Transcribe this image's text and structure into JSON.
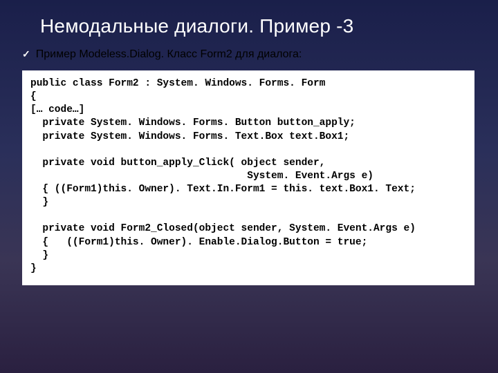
{
  "slide": {
    "title": "Немодальные диалоги. Пример -3",
    "bullet": {
      "text": "Пример Modeless.Dialog. Класс Form2 для диалога:"
    },
    "code": "public class Form2 : System. Windows. Forms. Form\n{\n[… code…]\n  private System. Windows. Forms. Button button_apply;\n  private System. Windows. Forms. Text.Box text.Box1;\n\n  private void button_apply_Click( object sender,\n                                    System. Event.Args e)\n  { ((Form1)this. Owner). Text.In.Form1 = this. text.Box1. Text; \n  }\n\n  private void Form2_Closed(object sender, System. Event.Args e)\n  {   ((Form1)this. Owner). Enable.Dialog.Button = true;    \n  }\n}"
  }
}
